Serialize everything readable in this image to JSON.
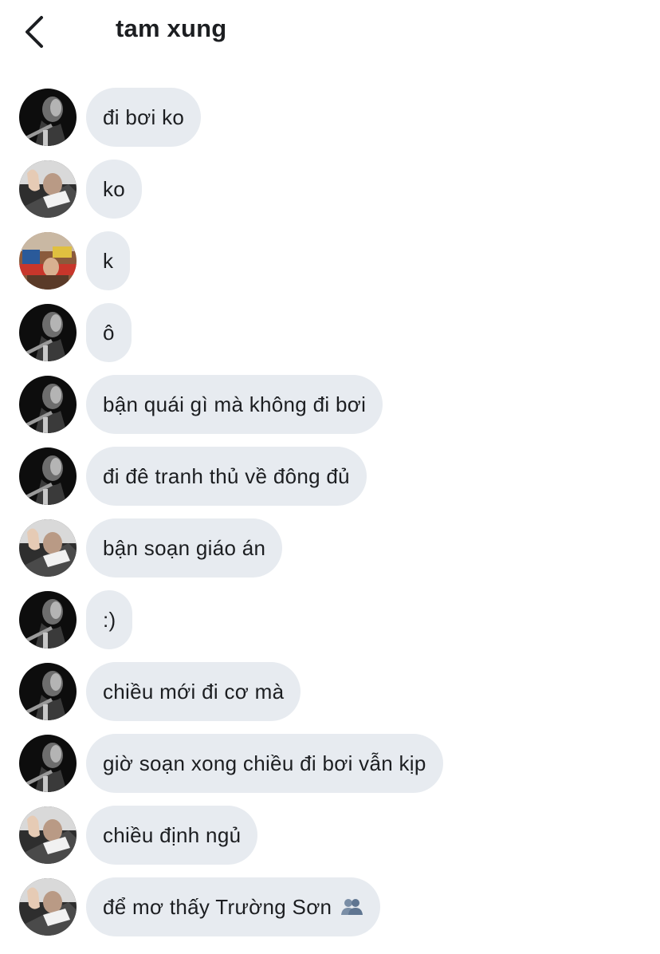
{
  "header": {
    "title": "tam xung",
    "back_icon": "chevron-left-icon"
  },
  "messages": [
    {
      "avatar": "avatar-a",
      "text": "đi bơi ko"
    },
    {
      "avatar": "avatar-b",
      "text": "ko"
    },
    {
      "avatar": "avatar-c",
      "text": "k"
    },
    {
      "avatar": "avatar-a",
      "text": "ô"
    },
    {
      "avatar": "avatar-a",
      "text": "bận quái gì mà không đi bơi"
    },
    {
      "avatar": "avatar-a",
      "text": "đi đê tranh thủ về đông đủ"
    },
    {
      "avatar": "avatar-b",
      "text": "bận soạn giáo án"
    },
    {
      "avatar": "avatar-a",
      "text": ":)"
    },
    {
      "avatar": "avatar-a",
      "text": "chiều mới đi cơ mà"
    },
    {
      "avatar": "avatar-a",
      "text": "giờ soạn xong chiều đi bơi vẫn kịp"
    },
    {
      "avatar": "avatar-b",
      "text": "chiều định ngủ"
    },
    {
      "avatar": "avatar-b",
      "text": "để mơ thấy Trường Sơn",
      "emoji": "people-silhouette-emoji"
    }
  ],
  "colors": {
    "bubble": "#e7ebf0",
    "text": "#1c1e21",
    "background": "#ffffff"
  }
}
